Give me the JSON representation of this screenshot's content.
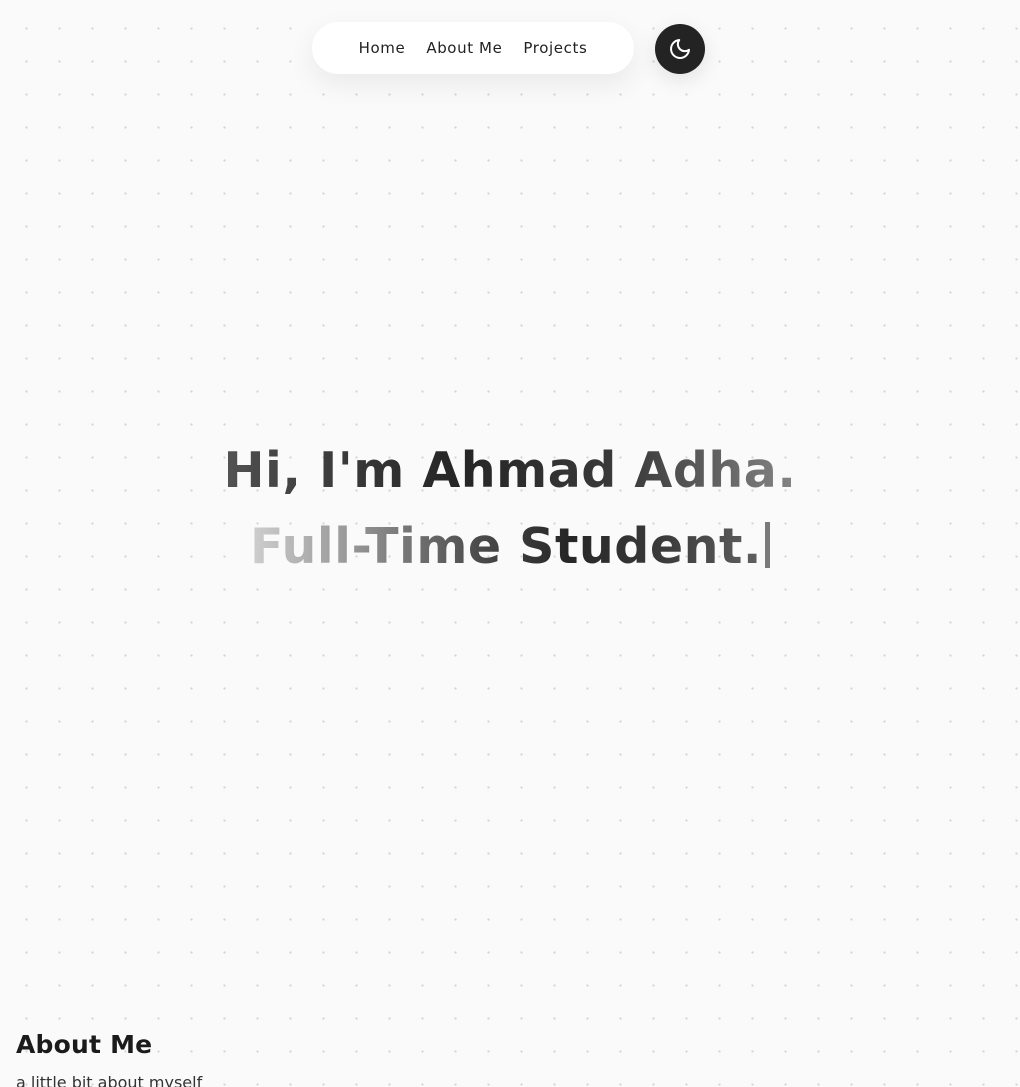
{
  "nav": {
    "links": [
      "Home",
      "About Me",
      "Projects"
    ],
    "theme_toggle_icon": "moon-icon"
  },
  "hero": {
    "line1": "Hi, I'm Ahmad Adha.",
    "line2": "Full-Time Student."
  },
  "about": {
    "title": "About Me",
    "subtitle": "a little bit about myself"
  },
  "colors": {
    "background": "#fafafa",
    "dot": "#d4d4d4",
    "nav_bg": "#ffffff",
    "toggle_bg": "#232323",
    "text": "#222222"
  }
}
